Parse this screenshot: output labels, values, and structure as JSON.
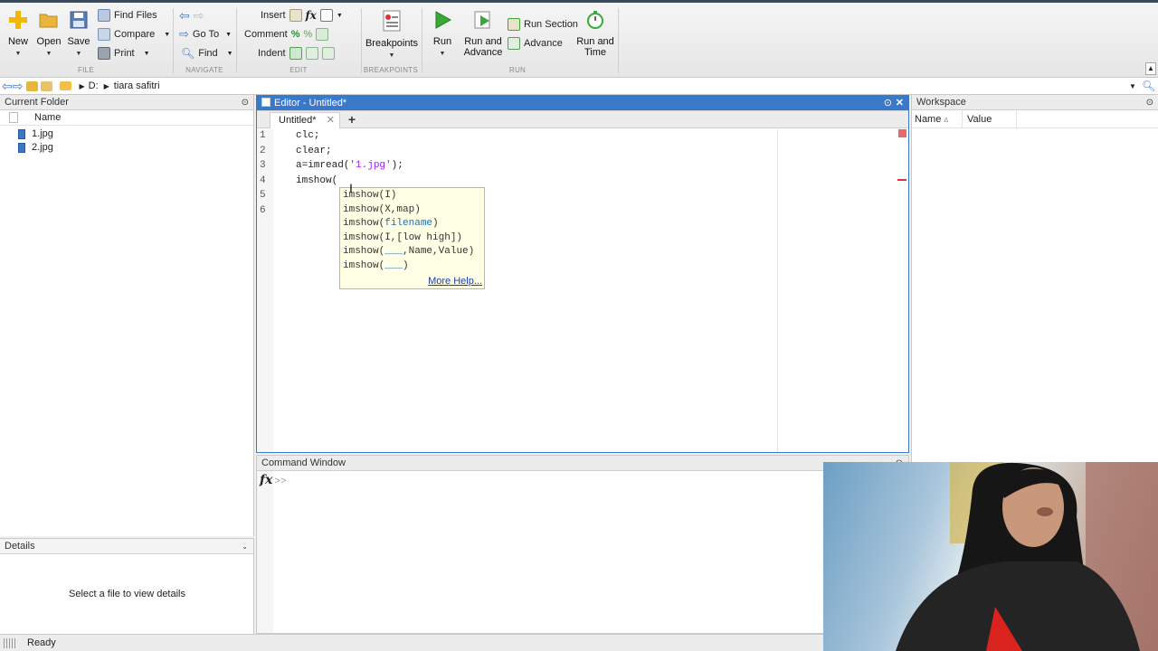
{
  "toolstrip": {
    "file": {
      "new": "New",
      "open": "Open",
      "save": "Save",
      "find_files": "Find Files",
      "compare": "Compare",
      "print": "Print",
      "section": "FILE"
    },
    "navigate": {
      "go_to": "Go To",
      "find": "Find",
      "section": "NAVIGATE"
    },
    "edit": {
      "insert": "Insert",
      "comment": "Comment",
      "indent": "Indent",
      "fx": "fx",
      "section": "EDIT"
    },
    "breakpoints": {
      "label": "Breakpoints",
      "section": "BREAKPOINTS"
    },
    "run": {
      "run": "Run",
      "run_and_advance_1": "Run and",
      "run_and_advance_2": "Advance",
      "run_section": "Run Section",
      "advance": "Advance",
      "run_and_time_1": "Run and",
      "run_and_time_2": "Time",
      "section": "RUN"
    }
  },
  "address": {
    "drive": "D:",
    "folder": "tiara safitri"
  },
  "current_folder": {
    "title": "Current Folder",
    "column": "Name",
    "files": [
      "1.jpg",
      "2.jpg"
    ]
  },
  "details": {
    "title": "Details",
    "message": "Select a file to view details"
  },
  "editor": {
    "title": "Editor - Untitled*",
    "tab": "Untitled*",
    "lines": [
      {
        "num": "1",
        "code": "clc;"
      },
      {
        "num": "2",
        "code": "clear;"
      },
      {
        "num": "3",
        "pre": "a=imread(",
        "str": "'1.jpg'",
        "post": ");"
      },
      {
        "num": "4",
        "code": "imshow("
      },
      {
        "num": "5",
        "code": ""
      },
      {
        "num": "6",
        "code": ""
      }
    ]
  },
  "autocomplete": {
    "items": [
      {
        "pre": "imshow(I)",
        "kw": "",
        "post": ""
      },
      {
        "pre": "imshow(X,map)",
        "kw": "",
        "post": ""
      },
      {
        "pre": "imshow(",
        "kw": "filename",
        "post": ")"
      },
      {
        "pre": "imshow(I,[low high])",
        "kw": "",
        "post": ""
      },
      {
        "pre": "imshow(",
        "kw": "___",
        "post": ",Name,Value)"
      },
      {
        "pre": "imshow(",
        "kw": "___",
        "post": ")"
      }
    ],
    "more_help": "More Help..."
  },
  "command_window": {
    "title": "Command Window",
    "fx": "fx",
    "prompt": ">>"
  },
  "workspace": {
    "title": "Workspace",
    "col_name": "Name",
    "col_value": "Value"
  },
  "status": {
    "text": "Ready"
  },
  "colors": {
    "editor_title_bg": "#3a78c9",
    "link": "#1a3fb0",
    "string": "#a020f0",
    "error": "#e03030"
  }
}
